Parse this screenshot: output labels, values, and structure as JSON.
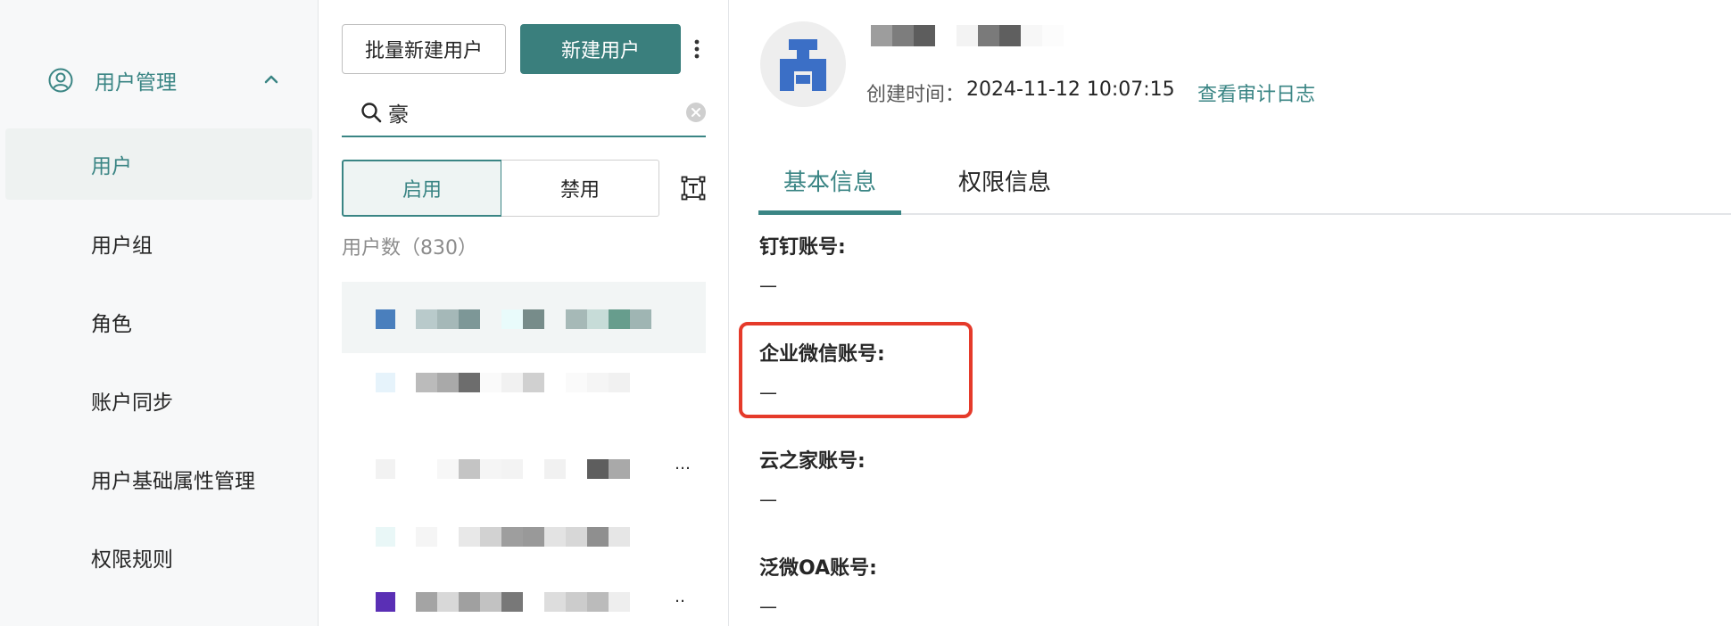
{
  "sidebar": {
    "group": {
      "label": "用户管理",
      "icon": "user-circle-icon",
      "expanded": true
    },
    "items": [
      {
        "label": "用户",
        "active": true
      },
      {
        "label": "用户组"
      },
      {
        "label": "角色"
      },
      {
        "label": "账户同步"
      },
      {
        "label": "用户基础属性管理"
      },
      {
        "label": "权限规则"
      }
    ]
  },
  "list": {
    "batch_create_label": "批量新建用户",
    "create_label": "新建用户",
    "search_value": "豪",
    "status_tabs": {
      "enabled": "启用",
      "disabled": "禁用"
    },
    "user_count": "用户数（830）"
  },
  "detail": {
    "created_label": "创建时间：",
    "created_value": "2024-11-12 10:07:15",
    "audit_link": "查看审计日志",
    "tabs": {
      "basic": "基本信息",
      "permission": "权限信息"
    },
    "fields": [
      {
        "label": "钉钉账号:",
        "value": "—"
      },
      {
        "label": "企业微信账号:",
        "value": "—"
      },
      {
        "label": "云之家账号:",
        "value": "—"
      },
      {
        "label": "泛微OA账号:",
        "value": "—"
      }
    ]
  },
  "colors": {
    "accent": "#3a8584",
    "primary_button": "#3a7f7d",
    "highlight": "#e53a2a",
    "avatar_logo": "#3b6fc6"
  }
}
